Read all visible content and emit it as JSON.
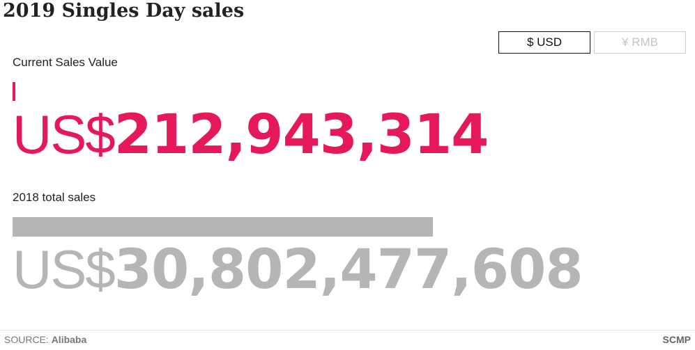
{
  "title": "2019 Singles Day sales",
  "currency_toggle": {
    "usd_label": "$ USD",
    "rmb_label": "¥ RMB",
    "selected": "USD"
  },
  "colors": {
    "current": "#e5195a",
    "previous": "#b5b5b5"
  },
  "current": {
    "label": "Current Sales Value",
    "prefix": "US$",
    "value_text": "212,943,314"
  },
  "previous": {
    "label": "2018 total sales",
    "prefix": "US$",
    "value_text": "30,802,477,608"
  },
  "footer": {
    "source_prefix": "SOURCE:",
    "source_name": "Alibaba",
    "brand": "SCMP"
  },
  "chart_data": {
    "type": "bar",
    "categories": [
      "Current Sales Value",
      "2018 total sales"
    ],
    "values": [
      212943314,
      30802477608
    ],
    "unit": "US$"
  }
}
